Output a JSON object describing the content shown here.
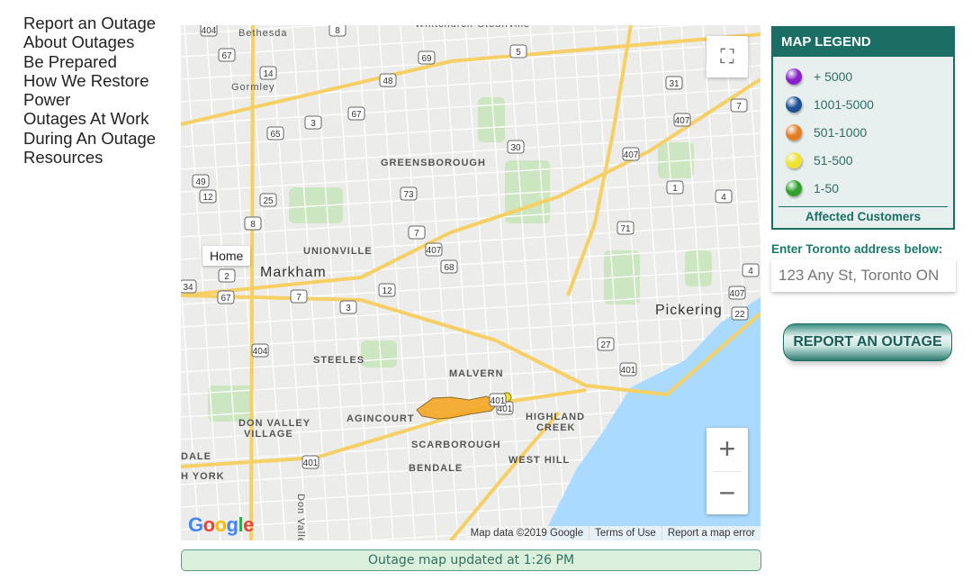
{
  "nav": {
    "items": [
      "Report an Outage",
      "About Outages",
      "Be Prepared",
      "How We Restore Power",
      "Outages At Work",
      "During An Outage",
      "Resources"
    ]
  },
  "map": {
    "places": [
      "Bethesda",
      "Gormley",
      "GREENSBOROUGH",
      "UNIONVILLE",
      "Markham",
      "Pickering",
      "STEELES",
      "MALVERN",
      "HIGHLAND",
      "CREEK",
      "DON VALLEY",
      "VILLAGE",
      "AGINCOURT",
      "SCARBOROUGH",
      "BENDALE",
      "WEST HILL",
      "H YORK",
      "DALE",
      "Whitchurch-Stouffville",
      "Don Valley P"
    ],
    "shields": [
      "404",
      "67",
      "8",
      "69",
      "5",
      "14",
      "48",
      "31",
      "67",
      "3",
      "65",
      "407",
      "7",
      "30",
      "407",
      "49",
      "12",
      "25",
      "73",
      "8",
      "7",
      "407",
      "1",
      "4",
      "71",
      "68",
      "4",
      "2",
      "12",
      "67",
      "7",
      "407",
      "3",
      "401",
      "22",
      "404",
      "27",
      "401",
      "401",
      "34",
      "401"
    ],
    "home_tooltip": "Home",
    "fullscreen_icon": "fullscreen-icon",
    "zoom_in": "+",
    "zoom_out": "−",
    "google_logo": "Google",
    "attribution": {
      "data": "Map data ©2019 Google",
      "terms": "Terms of Use",
      "report": "Report a map error"
    },
    "colors": {
      "land": "#ececea",
      "water": "#aadaff",
      "highway": "#f6cf65",
      "park": "#cbe6c0",
      "outage": "#f5a623"
    }
  },
  "updated": "Outage map updated at 1:26 PM",
  "legend": {
    "title": "MAP LEGEND",
    "items": [
      {
        "label": "+ 5000",
        "color": "#8a1fc9"
      },
      {
        "label": "1001-5000",
        "color": "#1f4f95"
      },
      {
        "label": "501-1000",
        "color": "#e67b22"
      },
      {
        "label": "51-500",
        "color": "#f2e22a"
      },
      {
        "label": "1-50",
        "color": "#2fa12a"
      }
    ],
    "footer": "Affected Customers"
  },
  "address": {
    "label": "Enter Toronto address below:",
    "placeholder": "123 Any St, Toronto ON"
  },
  "report_button": "REPORT AN OUTAGE"
}
